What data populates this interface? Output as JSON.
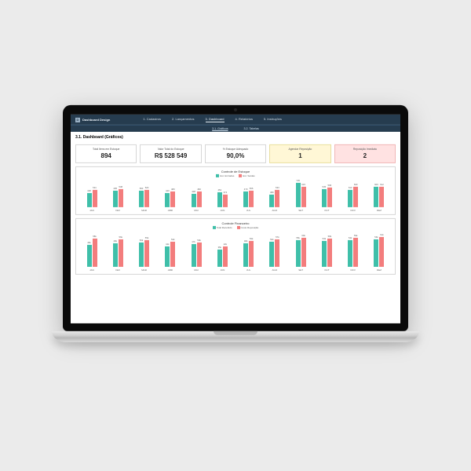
{
  "brand": "Dashboard Design",
  "menu": {
    "items": [
      "1. Cadastros",
      "2. Lançamentos",
      "3. Dashboard",
      "4. Relatórios",
      "5. Instruções"
    ],
    "active": 2
  },
  "submenu": {
    "items": [
      "3.1. Gráficos",
      "3.2. Tabelas"
    ],
    "active": 0
  },
  "page_title": "3.1. Dashboard (Gráficos)",
  "kpis": [
    {
      "label": "Total Itens em Estoque",
      "value": "894",
      "tone": "plain"
    },
    {
      "label": "Valor Total do Estoque",
      "value": "R$ 528 549",
      "tone": "plain"
    },
    {
      "label": "% Estoque Adequado",
      "value": "90,0%",
      "tone": "plain"
    },
    {
      "label": "Agendar Reposição",
      "value": "1",
      "tone": "warn"
    },
    {
      "label": "Reposição Imediata",
      "value": "2",
      "tone": "bad"
    }
  ],
  "chart1": {
    "title": "Controle de Estoque",
    "legend": [
      "Est. Entradas",
      "Est. Saídas"
    ],
    "colors": [
      "#3fbfa9",
      "#f37d7d"
    ]
  },
  "chart2": {
    "title": "Controle Financeiro",
    "legend": [
      "Total Recebido",
      "Custo Reposição"
    ],
    "colors": [
      "#3fbfa9",
      "#f37d7d"
    ]
  },
  "chart_data": [
    {
      "type": "bar",
      "title": "Controle de Estoque",
      "categories": [
        "JAN",
        "FEV",
        "MAR",
        "ABR",
        "MAI",
        "JUN",
        "JUL",
        "AGO",
        "SET",
        "OUT",
        "NOV",
        "DEZ"
      ],
      "series": [
        {
          "name": "Est. Entradas",
          "values": [
            438,
            495,
            500,
            440,
            408,
            452,
            470,
            380,
            725,
            535,
            513,
            606
          ]
        },
        {
          "name": "Est. Saídas",
          "values": [
            531,
            538,
            520,
            480,
            482,
            374,
            506,
            533,
            615,
            596,
            609,
            612
          ]
        }
      ],
      "ylim": [
        0,
        800
      ]
    },
    {
      "type": "bar",
      "title": "Controle Financeiro",
      "categories": [
        "JAN",
        "FEV",
        "MAR",
        "ABR",
        "MAI",
        "JUN",
        "JUL",
        "AGO",
        "SET",
        "OUT",
        "NOV",
        "DEZ"
      ],
      "series": [
        {
          "name": "Total Recebido",
          "values": [
            45000,
            49000,
            50000,
            42000,
            47000,
            35000,
            48000,
            52000,
            55000,
            53000,
            54000,
            56000
          ]
        },
        {
          "name": "Custo Reposição",
          "values": [
            58000,
            56000,
            55000,
            52000,
            50000,
            42000,
            53000,
            57000,
            60000,
            58000,
            59000,
            61000
          ]
        }
      ],
      "ylim": [
        0,
        70000
      ]
    }
  ]
}
